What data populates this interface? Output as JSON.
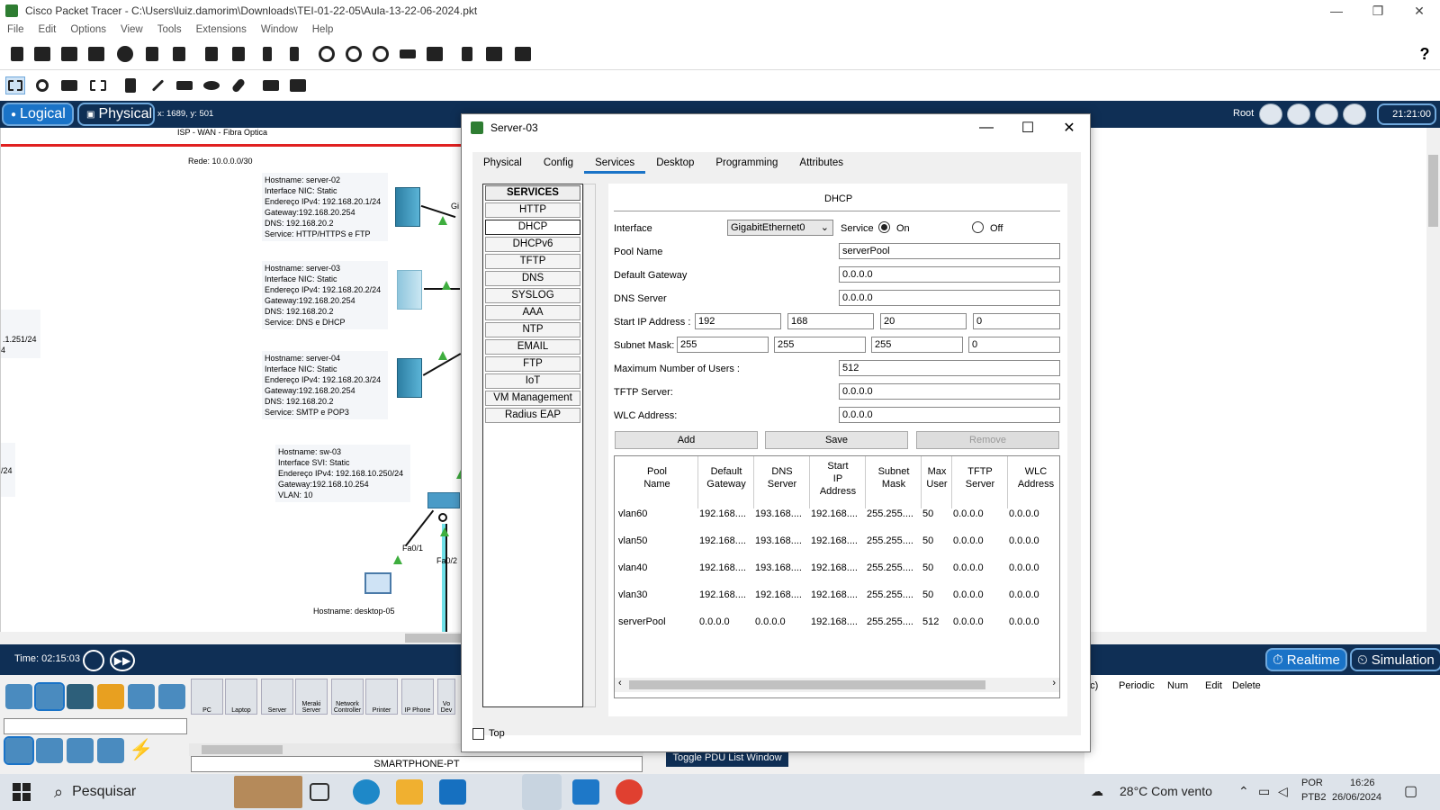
{
  "window": {
    "title": "Cisco Packet Tracer - C:\\Users\\luiz.damorim\\Downloads\\TEI-01-22-05\\Aula-13-22-06-2024.pkt",
    "min": "—",
    "max": "❐",
    "close": "✕"
  },
  "menu": [
    "File",
    "Edit",
    "Options",
    "View",
    "Tools",
    "Extensions",
    "Window",
    "Help"
  ],
  "help_icon": "?",
  "logical_bar": {
    "logical": "Logical",
    "physical": "Physical",
    "coords": "x: 1689, y: 501",
    "root": "Root",
    "clock": "21:21:00"
  },
  "workspace": {
    "isp_label": "ISP - WAN - Fibra Optica",
    "rede_label": "Rede: 10.0.0.0/30",
    "side_label_1": ".1.251/24",
    "side_label_1b": "4",
    "side_label_2": "/24",
    "server02": [
      "Hostname: server-02",
      "Interface NIC: Static",
      "Endereço IPv4: 192.168.20.1/24",
      "Gateway:192.168.20.254",
      "DNS: 192.168.20.2",
      "Service: HTTP/HTTPS e FTP"
    ],
    "server03": [
      "Hostname: server-03",
      "Interface NIC: Static",
      "Endereço IPv4: 192.168.20.2/24",
      "Gateway:192.168.20.254",
      "DNS: 192.168.20.2",
      "Service: DNS e DHCP"
    ],
    "server04": [
      "Hostname: server-04",
      "Interface NIC: Static",
      "Endereço IPv4: 192.168.20.3/24",
      "Gateway:192.168.20.254",
      "DNS: 192.168.20.2",
      "Service: SMTP e POP3"
    ],
    "sw03": [
      "Hostname: sw-03",
      "Interface SVI: Static",
      "Endereço IPv4: 192.168.10.250/24",
      "Gateway:192.168.10.254",
      "VLAN: 10"
    ],
    "port_gi": "Gi",
    "port_fa01": "Fa0/1",
    "port_fa02": "Fa0/2",
    "desktop_label": "Hostname: desktop-05"
  },
  "timebar": {
    "time": "Time: 02:15:03",
    "realtime": "Realtime",
    "simulation": "Simulation"
  },
  "devices": [
    "PC",
    "Laptop",
    "Server",
    "Meraki Server",
    "Network Controller",
    "Printer",
    "IP Phone",
    "Vo Dev"
  ],
  "device_name": "SMARTPHONE-PT",
  "pdu": {
    "columns": [
      "ec)",
      "Periodic",
      "Num",
      "Edit",
      "Delete"
    ],
    "toggle": "Toggle PDU List Window"
  },
  "dialog": {
    "title": "Server-03",
    "tabs": [
      "Physical",
      "Config",
      "Services",
      "Desktop",
      "Programming",
      "Attributes"
    ],
    "active_tab": "Services",
    "services": [
      "SERVICES",
      "HTTP",
      "DHCP",
      "DHCPv6",
      "TFTP",
      "DNS",
      "SYSLOG",
      "AAA",
      "NTP",
      "EMAIL",
      "FTP",
      "IoT",
      "VM Management",
      "Radius EAP"
    ],
    "selected_service": "DHCP",
    "top_label": "Top",
    "dhcp": {
      "heading": "DHCP",
      "interface_label": "Interface",
      "interface_value": "GigabitEthernet0",
      "service_label": "Service",
      "on_label": "On",
      "off_label": "Off",
      "service_on": true,
      "pool_name_label": "Pool Name",
      "pool_name": "serverPool",
      "gateway_label": "Default Gateway",
      "gateway": "0.0.0.0",
      "dns_label": "DNS Server",
      "dns": "0.0.0.0",
      "start_ip_label": "Start IP Address :",
      "start_ip": [
        "192",
        "168",
        "20",
        "0"
      ],
      "mask_label": "Subnet Mask:",
      "mask": [
        "255",
        "255",
        "255",
        "0"
      ],
      "max_users_label": "Maximum Number of Users :",
      "max_users": "512",
      "tftp_label": "TFTP Server:",
      "tftp": "0.0.0.0",
      "wlc_label": "WLC Address:",
      "wlc": "0.0.0.0",
      "add": "Add",
      "save": "Save",
      "remove": "Remove",
      "table_headers": [
        "Pool\nName",
        "Default\nGateway",
        "DNS\nServer",
        "Start\nIP\nAddress",
        "Subnet\nMask",
        "Max\nUser",
        "TFTP\nServer",
        "WLC\nAddress"
      ],
      "rows": [
        [
          "vlan60",
          "192.168....",
          "193.168....",
          "192.168....",
          "255.255....",
          "50",
          "0.0.0.0",
          "0.0.0.0"
        ],
        [
          "vlan50",
          "192.168....",
          "193.168....",
          "192.168....",
          "255.255....",
          "50",
          "0.0.0.0",
          "0.0.0.0"
        ],
        [
          "vlan40",
          "192.168....",
          "193.168....",
          "192.168....",
          "255.255....",
          "50",
          "0.0.0.0",
          "0.0.0.0"
        ],
        [
          "vlan30",
          "192.168....",
          "192.168....",
          "192.168....",
          "255.255....",
          "50",
          "0.0.0.0",
          "0.0.0.0"
        ],
        [
          "serverPool",
          "0.0.0.0",
          "0.0.0.0",
          "192.168....",
          "255.255....",
          "512",
          "0.0.0.0",
          "0.0.0.0"
        ]
      ]
    }
  },
  "taskbar": {
    "search": "Pesquisar",
    "weather": "28°C  Com vento",
    "lang1": "POR",
    "lang2": "PTB2",
    "time": "16:26",
    "date": "26/06/2024"
  },
  "colors": {
    "accent_dark": "#0f2f55",
    "tab_underline": "#1a73c7",
    "link_green": "#3fae3f",
    "isp_line": "#e02020"
  }
}
